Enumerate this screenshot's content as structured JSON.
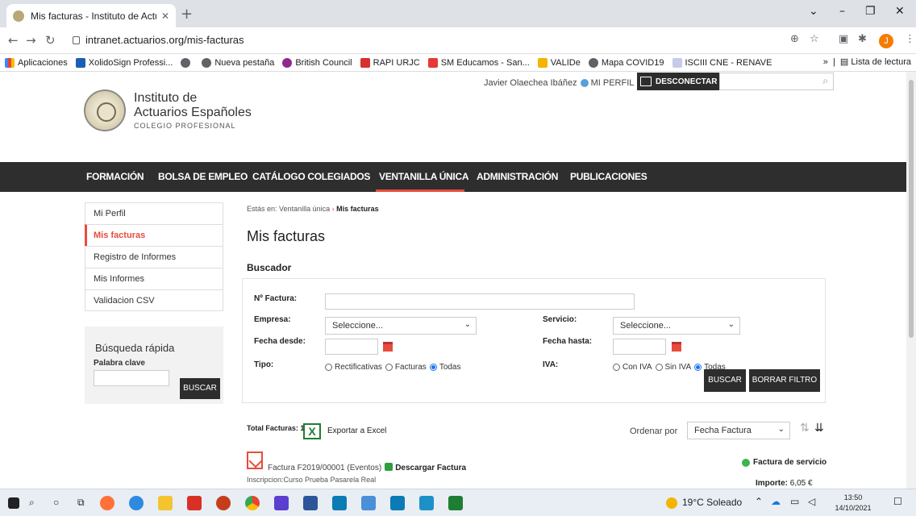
{
  "browser": {
    "tab_title": "Mis facturas - Instituto de Actuar",
    "tab_close": "✕",
    "new_tab": "+",
    "url": "intranet.actuarios.org/mis-facturas",
    "avatar_letter": "J",
    "bookmarks": [
      "Aplicaciones",
      "XolidoSign Professi...",
      "Nueva pestaña",
      "British Council",
      "RAPI URJC",
      "SM Educamos - San...",
      "VALIDe",
      "Mapa COVID19",
      "ISCIII CNE - RENAVE"
    ],
    "bookmarks_more": "»",
    "reading_list": "Lista de lectura"
  },
  "header": {
    "logo_line1": "Instituto de",
    "logo_line2": "Actuarios Españoles",
    "logo_line3": "COLEGIO PROFESIONAL",
    "user_name": "Javier Olaechea Ibáñez",
    "profile_link": "MI PERFIL",
    "disconnect": "DESCONECTAR"
  },
  "nav": {
    "items": [
      "FORMACIÓN",
      "BOLSA DE EMPLEO",
      "CATÁLOGO COLEGIADOS",
      "VENTANILLA ÚNICA",
      "ADMINISTRACIÓN",
      "PUBLICACIONES"
    ]
  },
  "sidebar": {
    "items": [
      "Mi Perfil",
      "Mis facturas",
      "Registro de Informes",
      "Mis Informes",
      "Validacion CSV"
    ],
    "quick_title": "Búsqueda rápida",
    "keyword_label": "Palabra clave",
    "search_button": "BUSCAR"
  },
  "breadcrumb": {
    "prefix": "Estás en:",
    "parent": "Ventanilla única",
    "separator": "›",
    "current": "Mis facturas"
  },
  "main": {
    "title": "Mis facturas",
    "search_title": "Buscador",
    "filters": {
      "invoice_no_label": "Nº Factura:",
      "company_label": "Empresa:",
      "company_value": "Seleccione...",
      "service_label": "Servicio:",
      "service_value": "Seleccione...",
      "date_from_label": "Fecha desde:",
      "date_to_label": "Fecha hasta:",
      "type_label": "Tipo:",
      "type_options": [
        "Rectificativas",
        "Facturas",
        "Todas"
      ],
      "iva_label": "IVA:",
      "iva_options": [
        "Con IVA",
        "Sin IVA",
        "Todas"
      ],
      "search_button": "BUSCAR",
      "clear_button": "BORRAR FILTRO"
    },
    "total_label": "Total Facturas: 1",
    "excel_glyph": "X",
    "export_label": "Exportar a Excel",
    "order_label": "Ordenar por",
    "order_value": "Fecha Factura",
    "invoice": {
      "text": "Factura F2019/00001 (Eventos)",
      "download": "Descargar Factura",
      "description": "Inscripcion:Curso Prueba Pasarela Real",
      "service_type": "Factura de servicio",
      "amount_label": "Importe:",
      "amount_value": "6,05 €"
    }
  },
  "taskbar": {
    "weather": "19°C Soleado",
    "time": "13:50",
    "date": "14/10/2021"
  },
  "colors": {
    "accent": "#e74c3c",
    "nav_bg": "#2e2e2e",
    "button_dark": "#2d2d2d"
  }
}
